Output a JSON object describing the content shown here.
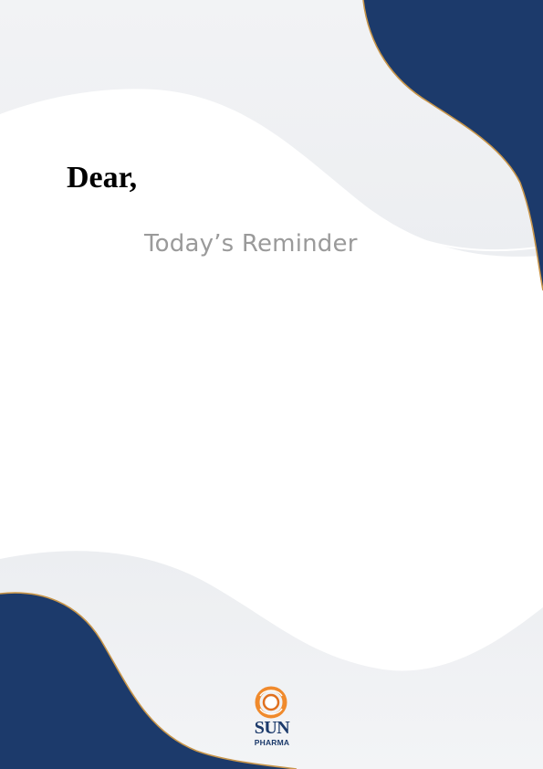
{
  "letter": {
    "greeting": "Dear,",
    "subtitle": "Today’s Reminder"
  },
  "brand": {
    "name": "SUN",
    "sub": "PHARMA"
  },
  "colors": {
    "navy": "#1c3a6b",
    "gold": "#c7954a",
    "grey_wave": "#eef0f3",
    "subtitle_text": "#9a9a9a",
    "logo_orange": "#f08a2c"
  },
  "icons": {
    "logo_mark": "sun-pharma-logo-icon"
  }
}
